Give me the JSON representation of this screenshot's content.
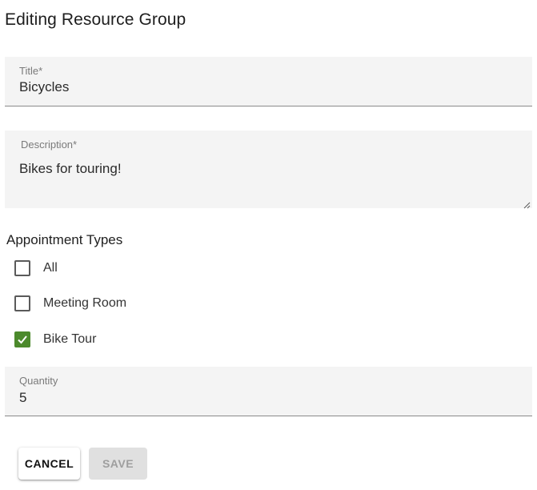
{
  "header": {
    "title": "Editing Resource Group"
  },
  "form": {
    "title_field": {
      "label": "Title*",
      "value": "Bicycles"
    },
    "description_field": {
      "label": "Description*",
      "value": "Bikes for touring!"
    },
    "appointment_types": {
      "label": "Appointment Types",
      "options": [
        {
          "label": "All",
          "checked": false
        },
        {
          "label": "Meeting Room",
          "checked": false
        },
        {
          "label": "Bike Tour",
          "checked": true
        }
      ]
    },
    "quantity_field": {
      "label": "Quantity",
      "value": "5"
    }
  },
  "actions": {
    "cancel_label": "CANCEL",
    "save_label": "SAVE"
  },
  "colors": {
    "checkbox_checked": "#4c8a2c",
    "field_background": "#f4f4f4",
    "save_disabled_bg": "#e0e0e0"
  }
}
